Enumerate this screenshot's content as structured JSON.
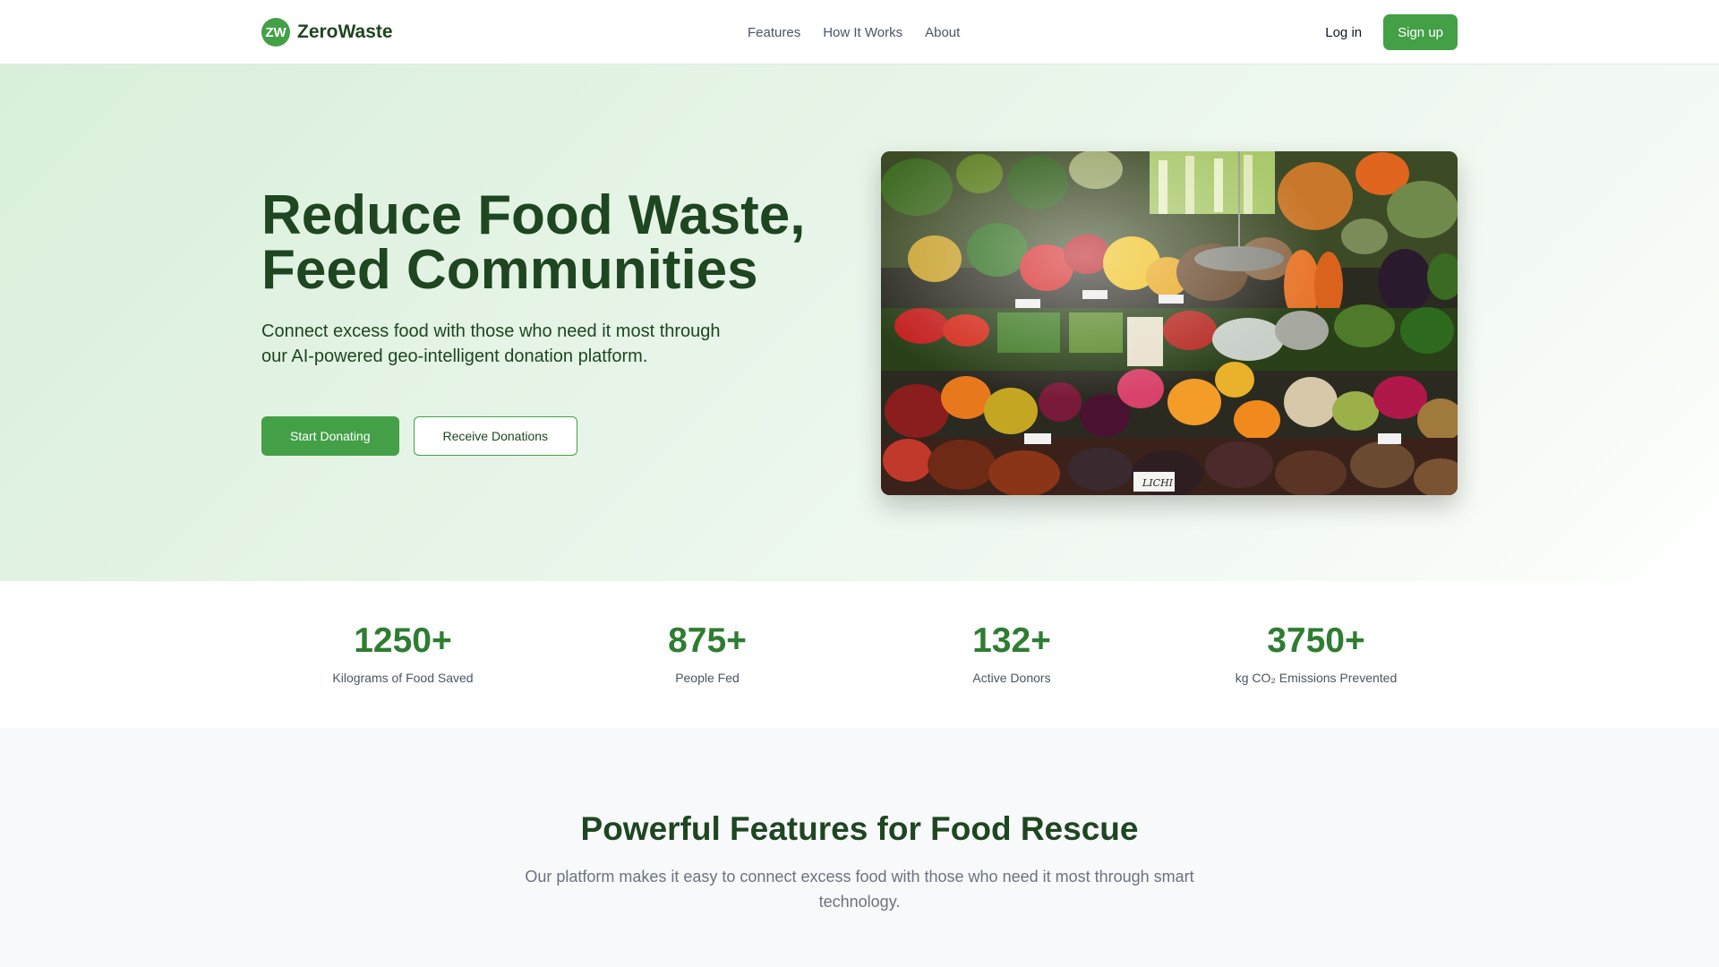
{
  "brand": {
    "logo_text": "ZW",
    "name": "ZeroWaste"
  },
  "nav": {
    "items": [
      "Features",
      "How It Works",
      "About"
    ]
  },
  "auth": {
    "login_label": "Log in",
    "signup_label": "Sign up"
  },
  "hero": {
    "title_line1": "Reduce Food Waste,",
    "title_line2": "Feed Communities",
    "subtitle": "Connect excess food with those who need it most through our AI-powered geo-intelligent donation platform.",
    "primary_button": "Start Donating",
    "secondary_button": "Receive Donations",
    "image_label": "LICHI"
  },
  "stats": [
    {
      "value": "1250+",
      "label": "Kilograms of Food Saved"
    },
    {
      "value": "875+",
      "label": "People Fed"
    },
    {
      "value": "132+",
      "label": "Active Donors"
    },
    {
      "value": "3750+",
      "label": "kg CO₂ Emissions Prevented"
    }
  ],
  "features": {
    "title": "Powerful Features for Food Rescue",
    "subtitle": "Our platform makes it easy to connect excess food with those who need it most through smart technology."
  },
  "colors": {
    "primary": "#43a047",
    "dark_green": "#1e4620",
    "stat_green": "#2e7d32",
    "muted_text": "#6b7280"
  }
}
